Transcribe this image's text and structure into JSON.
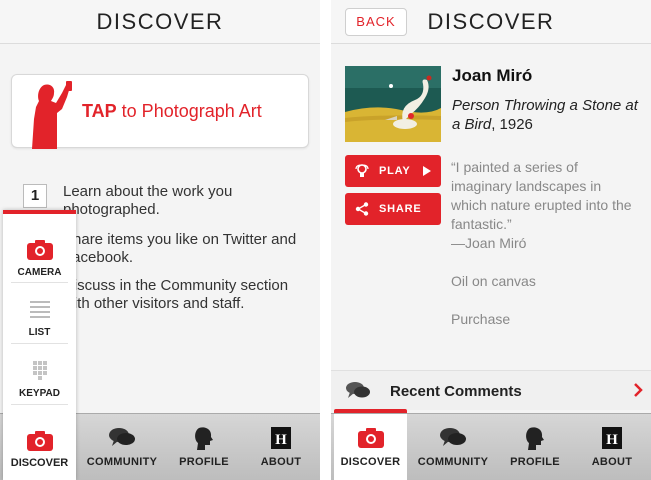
{
  "left_screen": {
    "header": {
      "title": "DISCOVER"
    },
    "tap_card": {
      "bold": "TAP",
      "rest": " to Photograph Art"
    },
    "steps": [
      {
        "number": "1",
        "bold": "Learn",
        "text": " about the work you photographed."
      },
      {
        "bold": "Share",
        "text": " items you like on Twitter and Facebook."
      },
      {
        "bold": "Discuss",
        "text": " in the Community section with other visitors and staff."
      }
    ],
    "popup_menu": {
      "items": [
        {
          "label": "CAMERA",
          "icon": "camera-icon"
        },
        {
          "label": "LIST",
          "icon": "list-icon"
        },
        {
          "label": "KEYPAD",
          "icon": "keypad-icon"
        },
        {
          "label": "DISCOVER",
          "icon": "camera-icon"
        }
      ]
    },
    "tabs": [
      {
        "label": "COMMUNITY",
        "icon": "chat-bubbles-icon"
      },
      {
        "label": "PROFILE",
        "icon": "head-profile-icon"
      },
      {
        "label": "ABOUT",
        "icon": "h-logo-icon"
      }
    ]
  },
  "right_screen": {
    "header": {
      "title": "DISCOVER",
      "back_label": "BACK"
    },
    "artwork": {
      "artist": "Joan Miró",
      "title": "Person Throwing a Stone at a Bird",
      "year": ", 1926",
      "medium": "Oil on canvas",
      "credit": "Purchase"
    },
    "buttons": {
      "play": "PLAY",
      "share": "SHARE"
    },
    "quote": {
      "text": "“I painted a series of imaginary landscapes in which nature erupted into the fantastic.”",
      "attribution": "—Joan Miró"
    },
    "comments": {
      "label": "Recent Comments"
    },
    "tabs": [
      {
        "label": "DISCOVER",
        "icon": "camera-icon",
        "active": true
      },
      {
        "label": "COMMUNITY",
        "icon": "chat-bubbles-icon",
        "active": false
      },
      {
        "label": "PROFILE",
        "icon": "head-profile-icon",
        "active": false
      },
      {
        "label": "ABOUT",
        "icon": "h-logo-icon",
        "active": false
      }
    ]
  },
  "colors": {
    "accent": "#e2232a",
    "muted_text": "#888888",
    "tabbar": "#c8c8c8"
  }
}
